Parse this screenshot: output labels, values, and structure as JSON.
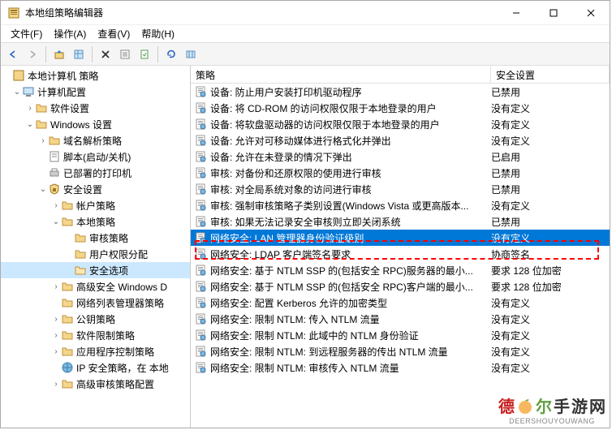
{
  "window": {
    "title": "本地组策略编辑器"
  },
  "menubar": {
    "file": "文件(F)",
    "action": "操作(A)",
    "view": "查看(V)",
    "help": "帮助(H)"
  },
  "tree": {
    "root": "本地计算机 策略",
    "computer_config": "计算机配置",
    "software_settings": "软件设置",
    "windows_settings": "Windows 设置",
    "dns_policy": "域名解析策略",
    "scripts": "脚本(启动/关机)",
    "printers": "已部署的打印机",
    "security_settings": "安全设置",
    "account_policies": "帐户策略",
    "local_policies": "本地策略",
    "audit_policy": "审核策略",
    "user_rights": "用户权限分配",
    "security_options": "安全选项",
    "advanced_windows": "高级安全 Windows D",
    "network_list": "网络列表管理器策略",
    "public_key": "公钥策略",
    "software_restriction": "软件限制策略",
    "app_control": "应用程序控制策略",
    "ip_security": "IP 安全策略，在 本地",
    "advanced_audit": "高级审核策略配置"
  },
  "list": {
    "header_policy": "策略",
    "header_setting": "安全设置",
    "rows": [
      {
        "policy": "设备: 防止用户安装打印机驱动程序",
        "setting": "已禁用"
      },
      {
        "policy": "设备: 将 CD-ROM 的访问权限仅限于本地登录的用户",
        "setting": "没有定义"
      },
      {
        "policy": "设备: 将软盘驱动器的访问权限仅限于本地登录的用户",
        "setting": "没有定义"
      },
      {
        "policy": "设备: 允许对可移动媒体进行格式化并弹出",
        "setting": "没有定义"
      },
      {
        "policy": "设备: 允许在未登录的情况下弹出",
        "setting": "已启用"
      },
      {
        "policy": "审核: 对备份和还原权限的使用进行审核",
        "setting": "已禁用"
      },
      {
        "policy": "审核: 对全局系统对象的访问进行审核",
        "setting": "已禁用"
      },
      {
        "policy": "审核: 强制审核策略子类别设置(Windows Vista 或更高版本...",
        "setting": "没有定义"
      },
      {
        "policy": "审核: 如果无法记录安全审核则立即关闭系统",
        "setting": "已禁用"
      },
      {
        "policy": "网络安全: LAN 管理器身份验证级别",
        "setting": "没有定义",
        "selected": true
      },
      {
        "policy": "网络安全: LDAP 客户端签名要求",
        "setting": "协商签名"
      },
      {
        "policy": "网络安全: 基于 NTLM SSP 的(包括安全 RPC)服务器的最小...",
        "setting": "要求 128 位加密"
      },
      {
        "policy": "网络安全: 基于 NTLM SSP 的(包括安全 RPC)客户端的最小...",
        "setting": "要求 128 位加密"
      },
      {
        "policy": "网络安全: 配置 Kerberos 允许的加密类型",
        "setting": "没有定义"
      },
      {
        "policy": "网络安全: 限制 NTLM: 传入 NTLM 流量",
        "setting": "没有定义"
      },
      {
        "policy": "网络安全: 限制 NTLM: 此域中的 NTLM 身份验证",
        "setting": "没有定义"
      },
      {
        "policy": "网络安全: 限制 NTLM: 到远程服务器的传出 NTLM 流量",
        "setting": "没有定义"
      },
      {
        "policy": "网络安全: 限制 NTLM: 审核传入 NTLM 流量",
        "setting": "没有定义"
      }
    ]
  },
  "watermark": {
    "text": "德尔手游网",
    "url": "DEERSHOUYOUWANG"
  }
}
